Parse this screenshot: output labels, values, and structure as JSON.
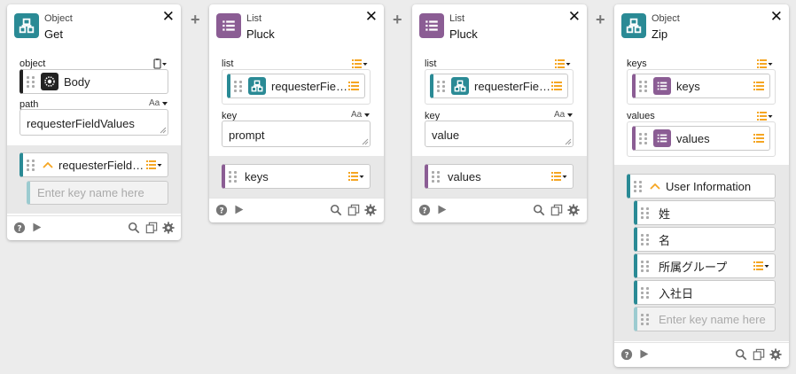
{
  "colors": {
    "teal": "#2a8a95",
    "purple": "#8b5d94",
    "orange": "#f5a623"
  },
  "cards": [
    {
      "type": "Object",
      "name": "Get",
      "object_label": "object",
      "object_value": "Body",
      "path_label": "path",
      "path_value": "requesterFieldValues",
      "path_tool": "Aa",
      "chip_value": "requesterFieldVal...",
      "key_placeholder": "Enter key name here"
    },
    {
      "type": "List",
      "name": "Pluck",
      "list_label": "list",
      "list_value": "requesterFieldV...",
      "key_label": "key",
      "key_value": "prompt",
      "key_tool": "Aa",
      "out_value": "keys"
    },
    {
      "type": "List",
      "name": "Pluck",
      "list_label": "list",
      "list_value": "requesterFieldV...",
      "key_label": "key",
      "key_value": "value",
      "key_tool": "Aa",
      "out_value": "values"
    },
    {
      "type": "Object",
      "name": "Zip",
      "keys_label": "keys",
      "keys_value": "keys",
      "values_label": "values",
      "values_value": "values",
      "group_title": "User Information",
      "items": [
        "姓",
        "名",
        "所属グループ",
        "入社日"
      ],
      "key_placeholder": "Enter key name here"
    }
  ],
  "icons": [
    "close-icon",
    "plus-icon",
    "object-icon",
    "list-icon",
    "list-menu-icon",
    "help-icon",
    "play-icon",
    "search-icon",
    "copy-icon",
    "gear-icon",
    "clipboard-icon",
    "chevron-up-icon"
  ]
}
